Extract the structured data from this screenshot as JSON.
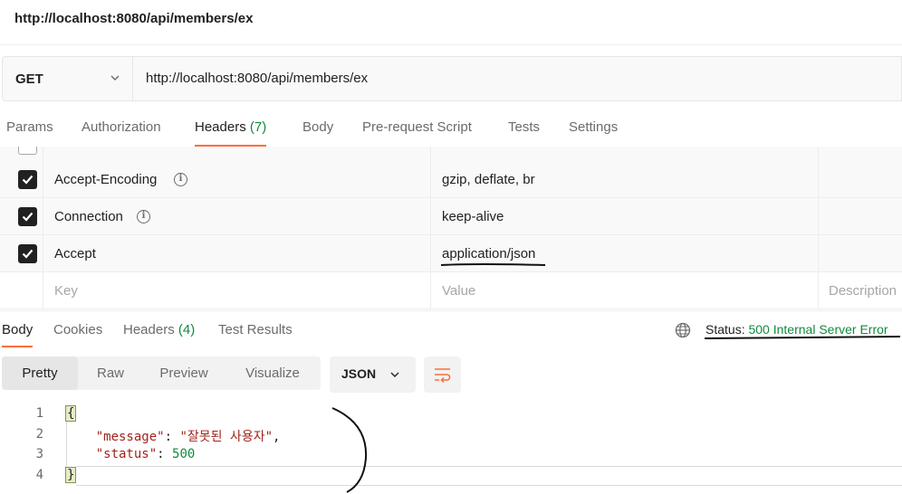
{
  "title": "http://localhost:8080/api/members/ex",
  "request": {
    "method": "GET",
    "url": "http://localhost:8080/api/members/ex"
  },
  "request_tabs": [
    {
      "label": "Params"
    },
    {
      "label": "Authorization"
    },
    {
      "label": "Headers",
      "count": "(7)"
    },
    {
      "label": "Body"
    },
    {
      "label": "Pre-request Script"
    },
    {
      "label": "Tests"
    },
    {
      "label": "Settings"
    }
  ],
  "headers": [
    {
      "key": "Accept-Encoding",
      "value": "gzip, deflate, br",
      "checked": true
    },
    {
      "key": "Connection",
      "value": "keep-alive",
      "checked": true
    },
    {
      "key": "Accept",
      "value": "application/json",
      "checked": true
    }
  ],
  "headers_placeholder": {
    "key": "Key",
    "value": "Value",
    "description": "Description"
  },
  "response_tabs": [
    {
      "label": "Body"
    },
    {
      "label": "Cookies"
    },
    {
      "label": "Headers",
      "count": "(4)"
    },
    {
      "label": "Test Results"
    }
  ],
  "status": {
    "prefix": "Status:",
    "code": "500 Internal Server Error"
  },
  "view_modes": [
    "Pretty",
    "Raw",
    "Preview",
    "Visualize"
  ],
  "format": "JSON",
  "code": {
    "line_numbers": [
      "1",
      "2",
      "3",
      "4"
    ],
    "open_brace": "{",
    "message_key": "\"message\"",
    "message_value": "\"잘못된 사용자\"",
    "status_key": "\"status\"",
    "status_value": "500",
    "close_brace": "}"
  },
  "colors": {
    "accent": "#ff6c37",
    "success": "#0f8b3d",
    "string": "#a2231a"
  }
}
